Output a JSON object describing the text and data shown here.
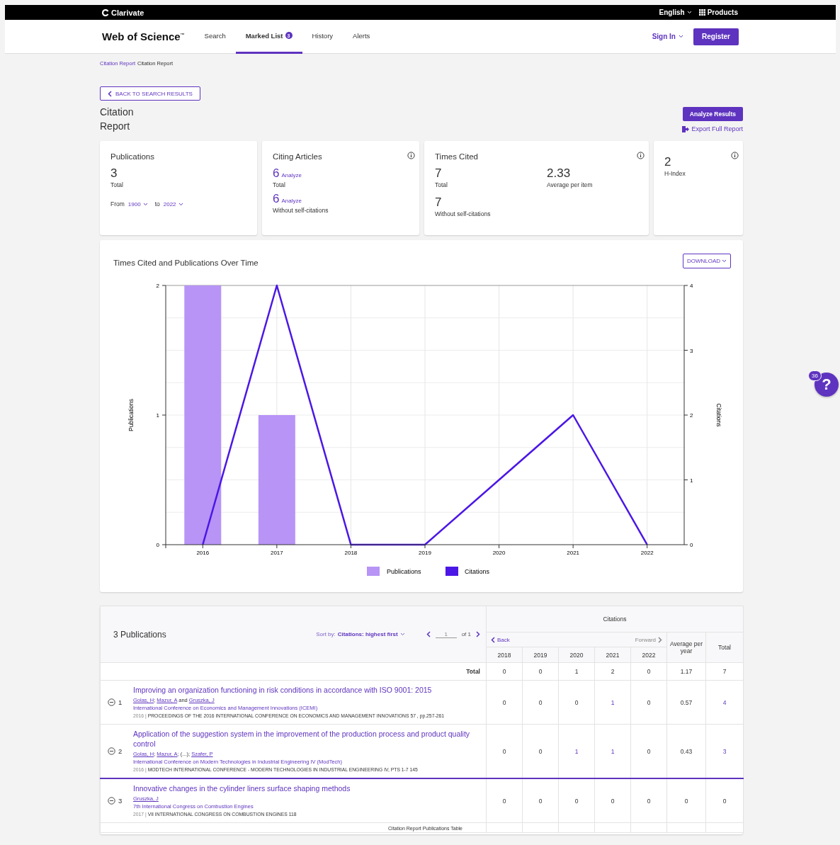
{
  "top_bar": {
    "brand": "Clarivate",
    "language": "English",
    "products": "Products"
  },
  "nav": {
    "logo": "Web of Science$^{™}$",
    "tabs": [
      {
        "label": "Search",
        "selected": false
      },
      {
        "label": "Marked List",
        "badge": "3",
        "selected": true
      },
      {
        "label": "History",
        "selected": false
      },
      {
        "label": "Alerts",
        "selected": false
      }
    ],
    "sign_in": "Sign In",
    "register": "Register"
  },
  "breadcrumb": [
    {
      "label": "Citation Report",
      "kind": "link"
    },
    {
      "label": "Citation Report",
      "kind": "current"
    }
  ],
  "back_button": "BACK TO SEARCH RESULTS",
  "title": "Citation Report",
  "analyze_button": "Analyze Results",
  "export_link": "Export Full Report",
  "publications_card": {
    "title": "Publications",
    "value": "3",
    "value_label": "Total",
    "from_label": "From",
    "from": "1900",
    "to_label": "to",
    "to": "2022"
  },
  "citing_articles_card": {
    "title": "Citing Articles",
    "rows": [
      {
        "value": "6",
        "link": "Analyze",
        "label": "Total"
      },
      {
        "value": "6",
        "link": "Analyze",
        "label": "Without self-citations"
      }
    ]
  },
  "times_cited_card": {
    "title": "Times Cited",
    "total": {
      "value": "7",
      "label": "Total"
    },
    "average": {
      "value": "2.33",
      "label": "Average per item"
    },
    "without_self": {
      "value": "7",
      "label": "Without self-citations"
    }
  },
  "h_index_card": {
    "value": "2",
    "label": "H-Index"
  },
  "chart_panel": {
    "title": "Times Cited and Publications Over Time",
    "download": "DOWNLOAD",
    "chart_data": {
      "type": "bar",
      "ylabel": "Publications",
      "y2label": "Citations",
      "categories": [
        "2016",
        "2017",
        "2018",
        "2019",
        "2020",
        "2021",
        "2022"
      ],
      "series": [
        {
          "name": "Publications",
          "color": "#b794f6",
          "values": [
            2,
            1,
            0,
            0,
            0,
            0,
            0
          ]
        },
        {
          "name": "Citations",
          "type": "line",
          "axis": "y2",
          "color": "#4b17e6",
          "values": [
            0,
            4,
            0,
            0,
            1,
            2,
            0
          ]
        }
      ],
      "ylim": [
        0,
        2
      ],
      "yticks": [
        0,
        1,
        2
      ],
      "y2lim": [
        0,
        4
      ],
      "y2ticks": [
        0,
        1,
        2,
        3,
        4
      ],
      "grid": true,
      "legend": "bottom"
    }
  },
  "table": {
    "heading": "3 Publications",
    "sort_label": "Sort by:",
    "sort_value": "Citations: highest first",
    "page": "1",
    "page_of": "of 1",
    "citations_heading": "Citations",
    "back": "Back",
    "forward": "Forward",
    "years": [
      "2018",
      "2019",
      "2020",
      "2021",
      "2022"
    ],
    "average_heading": "Average per year",
    "total_heading": "Total",
    "total_row": {
      "label": "Total",
      "values": [
        "0",
        "0",
        "1",
        "2",
        "0",
        "1.17",
        "7"
      ]
    },
    "rows": [
      {
        "number": "1",
        "title": "Improving an organization functioning in risk conditions in accordance with ISO 9001: 2015",
        "authors": [
          {
            "text": "Golas, H",
            "kind": "link"
          },
          {
            "text": "; ",
            "kind": "plain"
          },
          {
            "text": "Mazur, A",
            "kind": "link"
          },
          {
            "text": " and ",
            "kind": "plain"
          },
          {
            "text": "Gruszka, J",
            "kind": "link"
          }
        ],
        "conference": "International Conference on Economics and Management Innovations (ICEMI)",
        "year": "2016",
        "separator": "|",
        "source": "PROCEEDINGS OF THE 2016 INTERNATIONAL CONFERENCE ON ECONOMICS AND MANAGEMENT INNOVATIONS 57 , pp.257-261",
        "highlighted": false,
        "cells": [
          {
            "value": "0",
            "link": false
          },
          {
            "value": "0",
            "link": false
          },
          {
            "value": "0",
            "link": false
          },
          {
            "value": "1",
            "link": true
          },
          {
            "value": "0",
            "link": false
          },
          {
            "value": "0.57",
            "link": false
          },
          {
            "value": "4",
            "link": true
          }
        ]
      },
      {
        "number": "2",
        "title": "Application of the suggestion system in the improvement of the production process and product quality control",
        "authors": [
          {
            "text": "Golas, H",
            "kind": "link"
          },
          {
            "text": "; ",
            "kind": "plain"
          },
          {
            "text": "Mazur, A",
            "kind": "link"
          },
          {
            "text": "; (...); ",
            "kind": "plain"
          },
          {
            "text": "Szafer, P",
            "kind": "link"
          }
        ],
        "conference": "International Conference on Modern Technologies in Industrial Engineering IV (ModTech)",
        "year": "2016",
        "separator": "|",
        "source": "MODTECH INTERNATIONAL CONFERENCE - MODERN TECHNOLOGIES IN INDUSTRIAL ENGINEERING IV, PTS 1-7 145",
        "highlighted": false,
        "cells": [
          {
            "value": "0",
            "link": false
          },
          {
            "value": "0",
            "link": false
          },
          {
            "value": "1",
            "link": true
          },
          {
            "value": "1",
            "link": true
          },
          {
            "value": "0",
            "link": false
          },
          {
            "value": "0.43",
            "link": false
          },
          {
            "value": "3",
            "link": true
          }
        ]
      },
      {
        "number": "3",
        "title": "Innovative changes in the cylinder liners surface shaping methods",
        "authors": [
          {
            "text": "Gruszka, J",
            "kind": "link"
          }
        ],
        "conference": "7th International Congress on Combustion Engines",
        "year": "2017",
        "separator": "|",
        "source": "VII INTERNATIONAL CONGRESS ON COMBUSTION ENGINES 118",
        "highlighted": true,
        "cells": [
          {
            "value": "0",
            "link": false
          },
          {
            "value": "0",
            "link": false
          },
          {
            "value": "0",
            "link": false
          },
          {
            "value": "0",
            "link": false
          },
          {
            "value": "0",
            "link": false
          },
          {
            "value": "0",
            "link": false
          },
          {
            "value": "0",
            "link": false
          }
        ]
      }
    ],
    "caption": "Citation Report Publications Table"
  },
  "help": {
    "badge": "36",
    "label": "?"
  }
}
